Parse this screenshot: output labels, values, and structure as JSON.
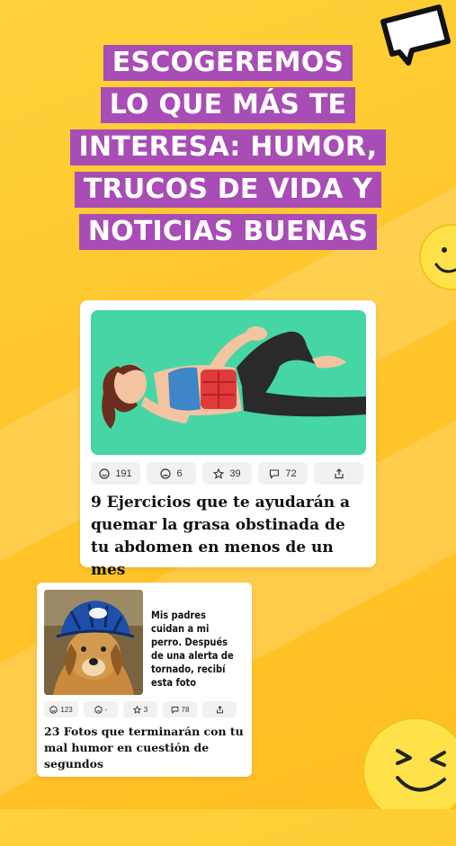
{
  "headline": {
    "lines": [
      "ESCOGEREMOS",
      "LO QUE MÁS TE",
      "INTERESA: HUMOR,",
      "TRUCOS DE VIDA Y",
      "NOTICIAS BUENAS"
    ]
  },
  "colors": {
    "background": "#FFC62C",
    "headline_bg": "#A84DB5",
    "image1_bg": "#46D6A6"
  },
  "cards": [
    {
      "image": "woman-exercise-illustration",
      "reactions": {
        "laugh": "191",
        "sad": "6",
        "star": "39",
        "comments": "72"
      },
      "title": "9 Ejercicios que te ayudarán a quemar la grasa obstinada de tu abdomen en menos de un mes"
    },
    {
      "image": "dog-with-helmet-photo",
      "caption": "Mis padres cuidan a mi perro. Después de una alerta de tornado, recibí esta foto",
      "reactions": {
        "laugh": "123",
        "sad": "-",
        "star": "3",
        "comments": "78"
      },
      "title": "23 Fotos que terminarán con tu mal humor en cuestión de segundos"
    }
  ],
  "icons": [
    "chat-bubble-icon",
    "smiley-face-icon",
    "laugh-icon",
    "sad-icon",
    "star-icon",
    "comment-icon",
    "share-icon"
  ]
}
